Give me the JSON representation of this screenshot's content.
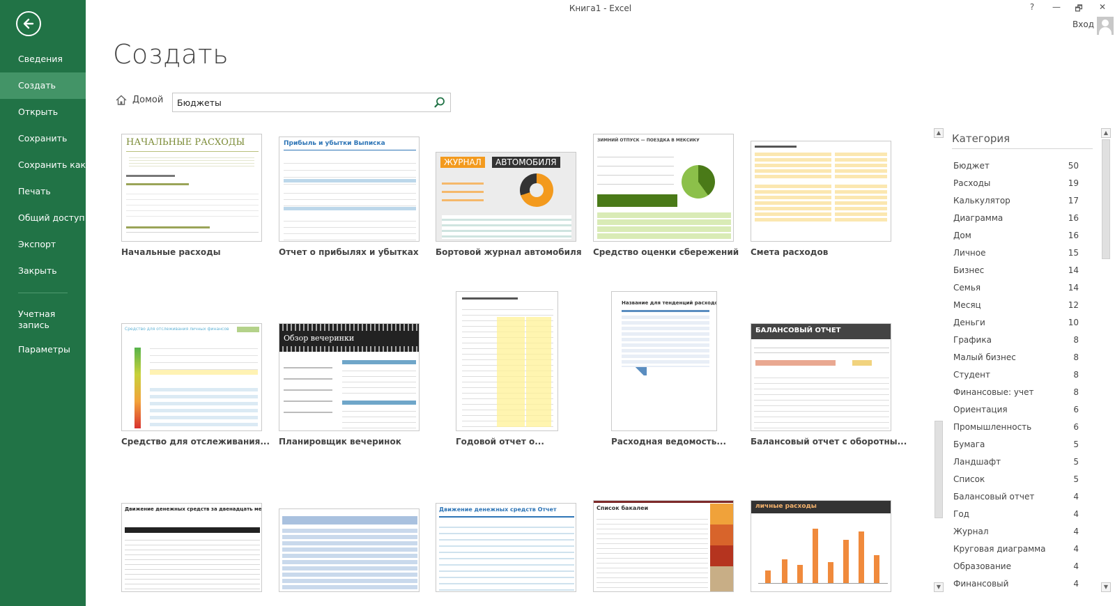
{
  "window": {
    "title": "Книга1 - Excel",
    "help": "?",
    "minimize": "—",
    "restore": "🗗",
    "close": "✕",
    "signin": "Вход"
  },
  "sidebar": {
    "items": [
      {
        "label": "Сведения"
      },
      {
        "label": "Создать",
        "active": true
      },
      {
        "label": "Открыть"
      },
      {
        "label": "Сохранить"
      },
      {
        "label": "Сохранить как"
      },
      {
        "label": "Печать"
      },
      {
        "label": "Общий доступ"
      },
      {
        "label": "Экспорт"
      },
      {
        "label": "Закрыть"
      }
    ],
    "account": "Учетная запись",
    "options": "Параметры"
  },
  "main": {
    "title": "Создать",
    "home_label": "Домой",
    "search_value": "Бюджеты"
  },
  "templates": [
    {
      "label": "Начальные расходы",
      "thumb_title": "НАЧАЛЬНЫЕ РАСХОДЫ"
    },
    {
      "label": "Отчет о прибылях и убытках",
      "thumb_title": "Прибыль и убытки Выписка"
    },
    {
      "label": "Бортовой журнал автомобиля",
      "thumb_title_a": "ЖУРНАЛ",
      "thumb_title_b": "АВТОМОБИЛЯ"
    },
    {
      "label": "Средство оценки сбережений",
      "thumb_title": "ЗИМНИЙ ОТПУСК — ПОЕЗДКА В МЕКСИКУ"
    },
    {
      "label": "Смета расходов"
    },
    {
      "label": "Средство для отслеживания...",
      "thumb_title": "Средство для отслеживания личных финансов"
    },
    {
      "label": "Планировщик вечеринок",
      "thumb_title": "Обзор вечеринки"
    },
    {
      "label": "Годовой отчет о..."
    },
    {
      "label": "Расходная ведомость...",
      "thumb_title": "Название для тенденций расходов"
    },
    {
      "label": "Балансовый отчет с оборотны...",
      "thumb_title": "БАЛАНСОВЫЙ ОТЧЕТ"
    },
    {
      "label": "",
      "thumb_title": "Движение денежных средств за двенадцать месяцев"
    },
    {
      "label": ""
    },
    {
      "label": "",
      "thumb_title": "Движение денежных средств Отчет"
    },
    {
      "label": "",
      "thumb_title": "Список бакалеи"
    },
    {
      "label": "",
      "thumb_title": "личные расходы"
    }
  ],
  "categories": {
    "title": "Категория",
    "items": [
      {
        "name": "Бюджет",
        "count": "50"
      },
      {
        "name": "Расходы",
        "count": "19"
      },
      {
        "name": "Калькулятор",
        "count": "17"
      },
      {
        "name": "Диаграмма",
        "count": "16"
      },
      {
        "name": "Дом",
        "count": "16"
      },
      {
        "name": "Личное",
        "count": "15"
      },
      {
        "name": "Бизнес",
        "count": "14"
      },
      {
        "name": "Семья",
        "count": "14"
      },
      {
        "name": "Месяц",
        "count": "12"
      },
      {
        "name": "Деньги",
        "count": "10"
      },
      {
        "name": "Графика",
        "count": "8"
      },
      {
        "name": "Малый бизнес",
        "count": "8"
      },
      {
        "name": "Студент",
        "count": "8"
      },
      {
        "name": "Финансовые: учет",
        "count": "8"
      },
      {
        "name": "Ориентация",
        "count": "6"
      },
      {
        "name": "Промышленность",
        "count": "6"
      },
      {
        "name": "Бумага",
        "count": "5"
      },
      {
        "name": "Ландшафт",
        "count": "5"
      },
      {
        "name": "Список",
        "count": "5"
      },
      {
        "name": "Балансовый отчет",
        "count": "4"
      },
      {
        "name": "Год",
        "count": "4"
      },
      {
        "name": "Журнал",
        "count": "4"
      },
      {
        "name": "Круговая диаграмма",
        "count": "4"
      },
      {
        "name": "Образование",
        "count": "4"
      },
      {
        "name": "Финансовый",
        "count": "4"
      }
    ]
  },
  "colors": {
    "sidebar": "#217346",
    "sidebar_active": "#439467",
    "accent_orange": "#f39a1e"
  }
}
